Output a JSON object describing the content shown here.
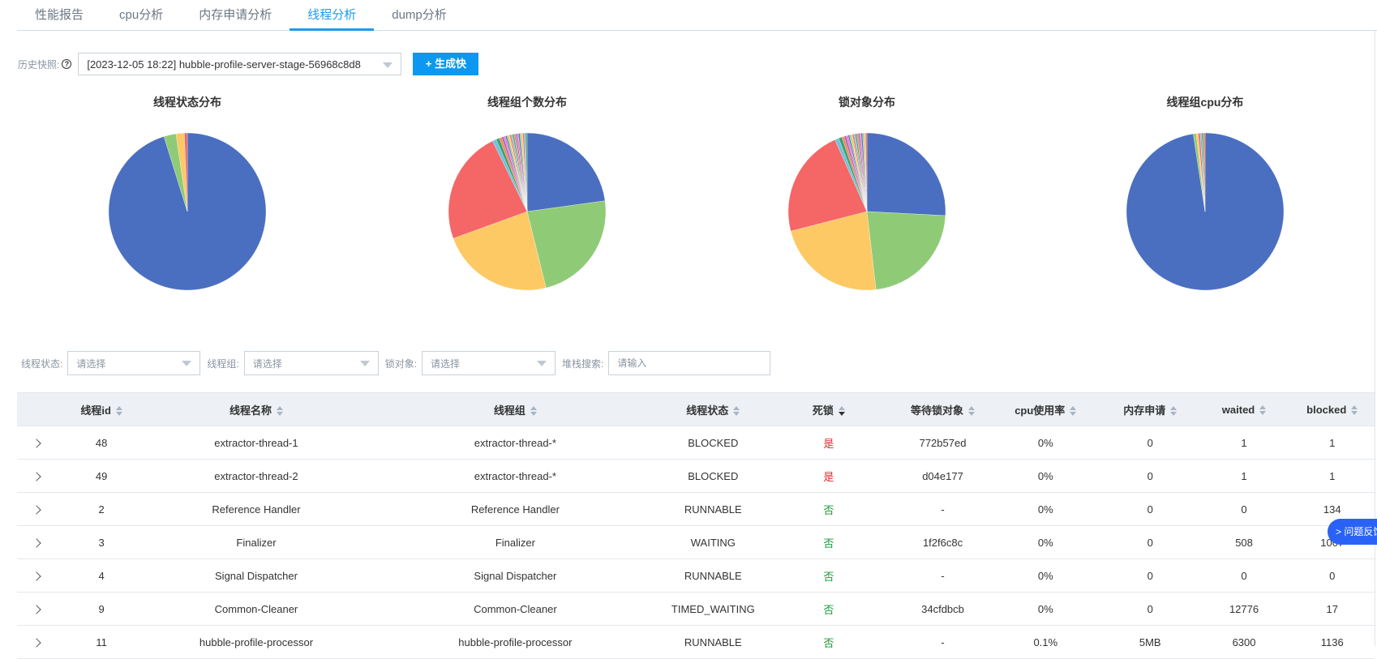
{
  "tabs": [
    {
      "label": "性能报告"
    },
    {
      "label": "cpu分析"
    },
    {
      "label": "内存申请分析"
    },
    {
      "label": "线程分析",
      "active": true
    },
    {
      "label": "dump分析"
    }
  ],
  "snapshot": {
    "label": "历史快照:",
    "help_icon": "question-circle-icon",
    "value": "[2023-12-05 18:22]  hubble-profile-server-stage-56968c8d8",
    "button": "+ 生成快照"
  },
  "colors": {
    "accent": "#0c98f0",
    "palette": [
      "#4a6fc0",
      "#8fcb77",
      "#fdc964",
      "#f56666",
      "#73c0de",
      "#3ba272",
      "#fc8452",
      "#9a60b4",
      "#ea7ccc"
    ]
  },
  "chart_data": [
    {
      "type": "pie",
      "title": "线程状态分布",
      "values": [
        95.2,
        2.5,
        1.7,
        0.6
      ]
    },
    {
      "type": "pie",
      "title": "线程组个数分布",
      "values": [
        23,
        23.5,
        23.5,
        23.5,
        0.8,
        0.7,
        0.5,
        0.4,
        0.4,
        0.3,
        0.3,
        0.3,
        0.3,
        0.3,
        0.3,
        0.3,
        0.3,
        0.3,
        0.3,
        0.3,
        0.3,
        0.3,
        0.3,
        0.3
      ]
    },
    {
      "type": "pie",
      "title": "锁对象分布",
      "values": [
        26,
        22.5,
        23,
        22.5,
        0.8,
        0.7,
        0.5,
        0.4,
        0.4,
        0.3,
        0.3,
        0.3,
        0.3,
        0.3,
        0.3,
        0.3,
        0.3,
        0.3,
        0.3,
        0.3,
        0.3,
        0.3
      ]
    },
    {
      "type": "pie",
      "title": "线程组cpu分布",
      "values": [
        97.6,
        0.6,
        0.4,
        0.4,
        0.3,
        0.3,
        0.4
      ]
    }
  ],
  "filters": {
    "state_label": "线程状态:",
    "group_label": "线程组:",
    "lock_label": "锁对象:",
    "stack_label": "堆栈搜索:",
    "select_placeholder": "请选择",
    "input_placeholder": "请输入"
  },
  "table": {
    "columns": [
      "线程id",
      "线程名称",
      "线程组",
      "线程状态",
      "死锁",
      "等待锁对象",
      "cpu使用率",
      "内存申请",
      "waited",
      "blocked"
    ],
    "rows": [
      [
        "48",
        "extractor-thread-1",
        "extractor-thread-*",
        "BLOCKED",
        "是",
        "772b57ed",
        "0%",
        "0",
        "1",
        "1"
      ],
      [
        "49",
        "extractor-thread-2",
        "extractor-thread-*",
        "BLOCKED",
        "是",
        "d04e177",
        "0%",
        "0",
        "1",
        "1"
      ],
      [
        "2",
        "Reference Handler",
        "Reference Handler",
        "RUNNABLE",
        "否",
        "-",
        "0%",
        "0",
        "0",
        "134"
      ],
      [
        "3",
        "Finalizer",
        "Finalizer",
        "WAITING",
        "否",
        "1f2f6c8c",
        "0%",
        "0",
        "508",
        "1007"
      ],
      [
        "4",
        "Signal Dispatcher",
        "Signal Dispatcher",
        "RUNNABLE",
        "否",
        "-",
        "0%",
        "0",
        "0",
        "0"
      ],
      [
        "9",
        "Common-Cleaner",
        "Common-Cleaner",
        "TIMED_WAITING",
        "否",
        "34cfdbcb",
        "0%",
        "0",
        "12776",
        "17"
      ],
      [
        "11",
        "hubble-profile-processor",
        "hubble-profile-processor",
        "RUNNABLE",
        "否",
        "-",
        "0.1%",
        "5MB",
        "6300",
        "1136"
      ]
    ]
  },
  "feedback": "问题反馈"
}
